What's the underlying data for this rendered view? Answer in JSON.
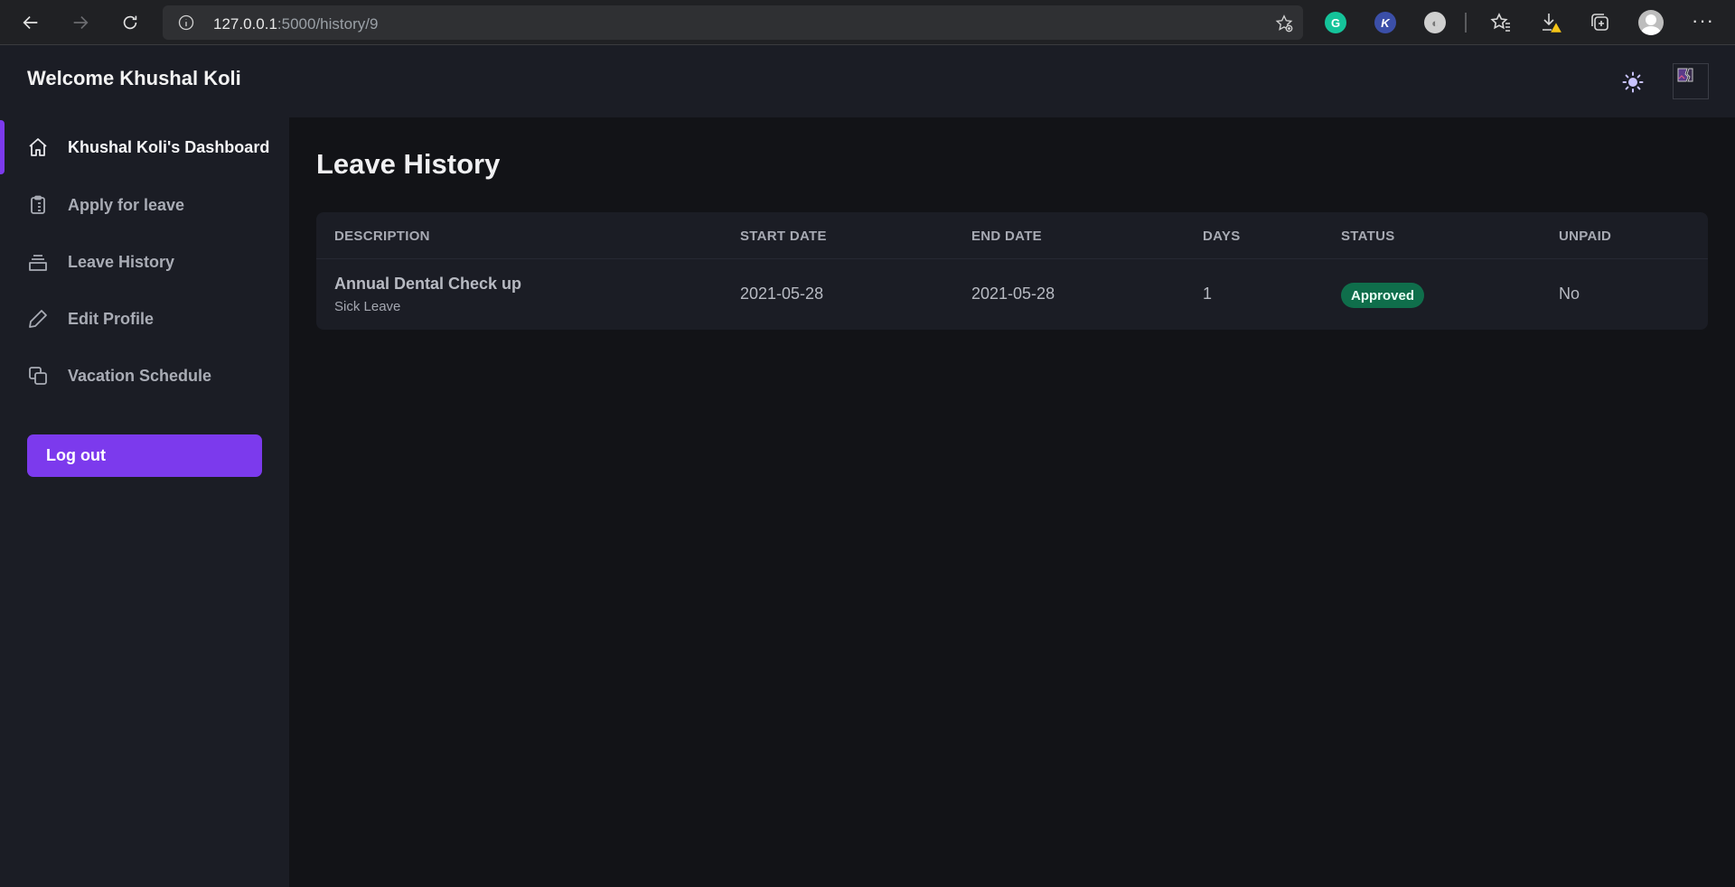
{
  "browser": {
    "url_host": "127.0.0.1",
    "url_rest": ":5000/history/9"
  },
  "header": {
    "welcome": "Welcome Khushal Koli"
  },
  "sidebar": {
    "items": [
      {
        "label": "Khushal Koli's Dashboard",
        "icon": "home-icon",
        "active": true
      },
      {
        "label": "Apply for leave",
        "icon": "clipboard-icon",
        "active": false
      },
      {
        "label": "Leave History",
        "icon": "inbox-icon",
        "active": false
      },
      {
        "label": "Edit Profile",
        "icon": "pencil-icon",
        "active": false
      },
      {
        "label": "Vacation Schedule",
        "icon": "copy-icon",
        "active": false
      }
    ],
    "logout_label": "Log out"
  },
  "main": {
    "title": "Leave History",
    "table": {
      "headers": [
        "DESCRIPTION",
        "START DATE",
        "END DATE",
        "DAYS",
        "STATUS",
        "UNPAID"
      ],
      "rows": [
        {
          "description": "Annual Dental Check up",
          "type": "Sick Leave",
          "start_date": "2021-05-28",
          "end_date": "2021-05-28",
          "days": "1",
          "status": "Approved",
          "unpaid": "No"
        }
      ]
    }
  },
  "colors": {
    "accent": "#7c3aed",
    "status_approved": "#0f6e4b",
    "background": "#121317",
    "panel": "#1b1d25"
  }
}
